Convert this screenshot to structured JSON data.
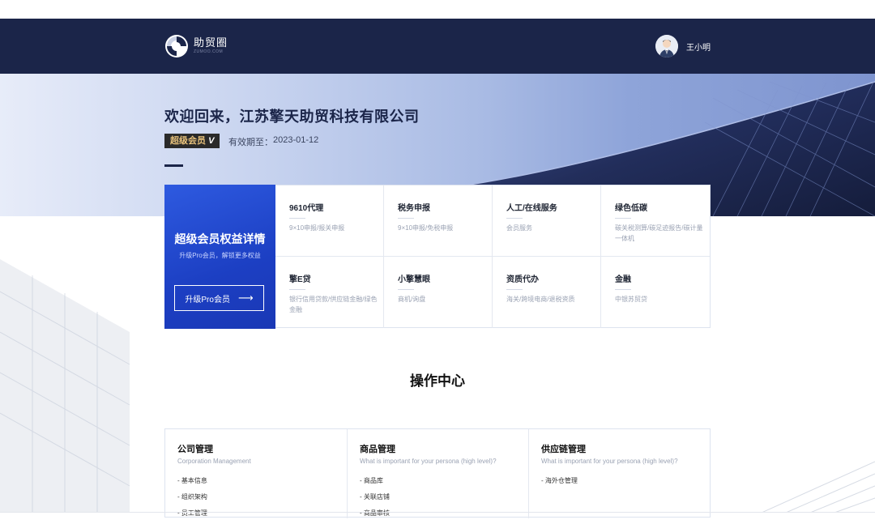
{
  "nav": {
    "logo_cn": "助贸圈",
    "logo_en": "ZUMOO.COM",
    "username": "王小明"
  },
  "hero": {
    "welcome": "欢迎回来，江苏擎天助贸科技有限公司",
    "member_badge": "超级会员",
    "badge_mark": "V",
    "expiry_label": "有效期至：",
    "expiry_date": "2023-01-12"
  },
  "benefits": {
    "title": "超级会员权益详情",
    "subtitle": "升级Pro会员，解锁更多权益",
    "upgrade_label": "升级Pro会员",
    "upgrade_arrow": "⟶",
    "items": [
      {
        "title": "9610代理",
        "desc": "9×10申报/报关申报"
      },
      {
        "title": "税务申报",
        "desc": "9×10申报/免税申报"
      },
      {
        "title": "人工/在线服务",
        "desc": "会员服务"
      },
      {
        "title": "绿色低碳",
        "desc": "碳关税测算/碳足迹报告/碳计量一体机"
      },
      {
        "title": "擎E贷",
        "desc": "银行信用贷款/供应链金融/绿色金融"
      },
      {
        "title": "小擎慧眼",
        "desc": "商机/询盘"
      },
      {
        "title": "资质代办",
        "desc": "海关/跨境电商/退税资质"
      },
      {
        "title": "金融",
        "desc": "中银苏贸贷"
      }
    ]
  },
  "operations": {
    "title": "操作中心",
    "columns": [
      {
        "title": "公司管理",
        "subtitle": "Corporation Management",
        "items": [
          "- 基本信息",
          "- 组织架构",
          "- 员工管理"
        ]
      },
      {
        "title": "商品管理",
        "subtitle": "What is important for your persona (high level)?",
        "items": [
          "- 商品库",
          "- 关联店铺",
          "- 商品审核"
        ]
      },
      {
        "title": "供应链管理",
        "subtitle": "What is important for your persona (high level)?",
        "items": [
          "- 海外仓管理"
        ]
      }
    ]
  },
  "colors": {
    "nav_bg": "#1b2549",
    "benefit_panel": "#1c3fc3",
    "badge_gold": "#e8c27c"
  }
}
